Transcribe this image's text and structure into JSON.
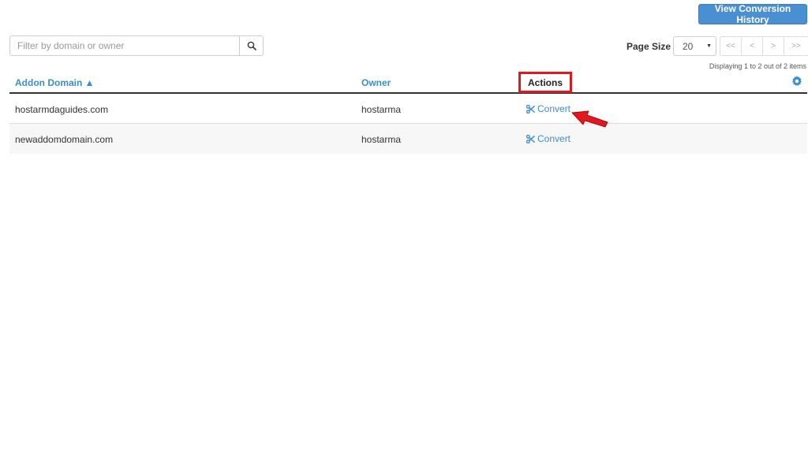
{
  "toolbar": {
    "history_button": "View Conversion History"
  },
  "search": {
    "placeholder": "Filter by domain or owner",
    "value": ""
  },
  "pagination": {
    "page_size_label": "Page Size",
    "page_size_value": "20",
    "first": "<<",
    "prev": "<",
    "next": ">",
    "last": ">>",
    "display_info": "Displaying 1 to 2 out of 2 items"
  },
  "table": {
    "headers": {
      "domain": "Addon Domain ▲",
      "owner": "Owner",
      "actions": "Actions"
    },
    "rows": [
      {
        "domain": "hostarmdaguides.com",
        "owner": "hostarma",
        "action": "Convert"
      },
      {
        "domain": "newaddomdomain.com",
        "owner": "hostarma",
        "action": "Convert"
      }
    ]
  },
  "colors": {
    "accent": "#3c8dcb",
    "button": "#4a8fd1",
    "highlight": "#e0191f"
  }
}
